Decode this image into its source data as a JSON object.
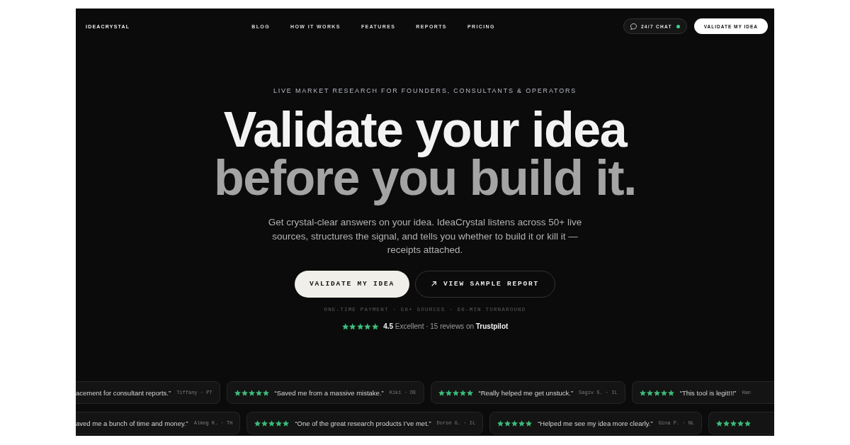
{
  "nav": {
    "logo": "IDEACRYSTAL",
    "links": [
      "BLOG",
      "HOW IT WORKS",
      "FEATURES",
      "REPORTS",
      "PRICING"
    ],
    "chat": {
      "label": "24/7 CHAT",
      "online": true
    },
    "cta": "VALIDATE MY IDEA"
  },
  "hero": {
    "kicker": "LIVE MARKET RESEARCH FOR FOUNDERS, CONSULTANTS & OPERATORS",
    "headline": [
      "Validate your idea",
      "before you build it."
    ],
    "description": "Get crystal-clear answers on your idea. IdeaCrystal listens across 50+ live sources, structures the signal, and tells you whether to build it or kill it — receipts attached.",
    "buttons": [
      {
        "label": "VALIDATE MY IDEA",
        "kind": "primary"
      },
      {
        "label": "VIEW SAMPLE REPORT",
        "kind": "secondary"
      }
    ],
    "features": "ONE-TIME PAYMENT · 50+ SOURCES · 60-MIN TURNAROUND",
    "rating": {
      "stars": 5,
      "text": "**4.5** Excellent · 15 reviews on **Trustpilot**"
    }
  },
  "testimonial_rows": [
    {
      "cards": [
        {
          "quote": "acement for consultant reports.”",
          "author": "Tiffany · PT"
        },
        {
          "stars": 5,
          "quote": "“Saved me from a massive mistake.”",
          "author": "Kiki · DE"
        },
        {
          "stars": 5,
          "quote": "“Really helped me get unstuck.”",
          "author": "Sagiv S. · IL"
        },
        {
          "stars": 5,
          "quote": "“This tool is legit!!!”",
          "author": "Han"
        }
      ]
    },
    {
      "cards": [
        {
          "quote": "aved me a bunch of time and money.”",
          "author": "Almog K. · TH"
        },
        {
          "stars": 5,
          "quote": "“One of the great research products I’ve met.”",
          "author": "Doron G. · IL"
        },
        {
          "stars": 5,
          "quote": "“Helped me see my idea more clearly.”",
          "author": "Gina P. · NL"
        },
        {
          "stars": 5
        }
      ]
    }
  ]
}
